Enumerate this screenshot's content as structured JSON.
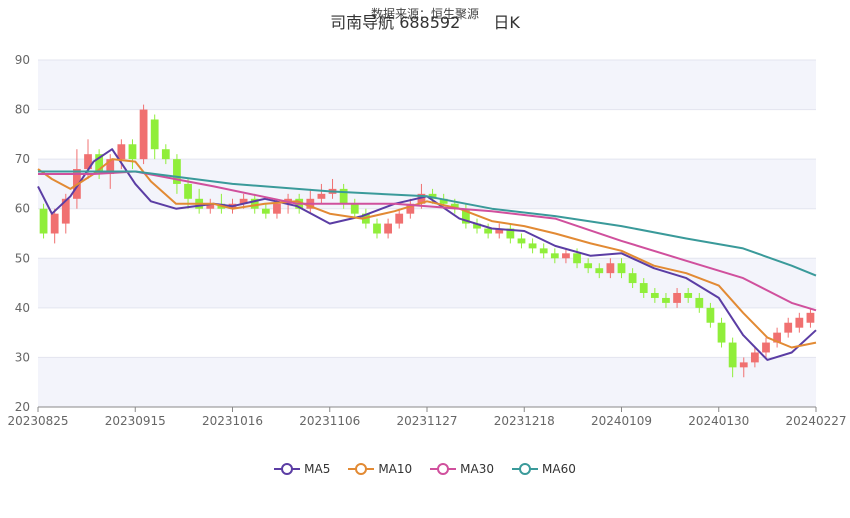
{
  "source": "数据来源：恒生聚源",
  "title": {
    "name": "司南导航 688592",
    "period": "日K"
  },
  "colors": {
    "up": "#f07070",
    "down": "#90ee3a",
    "MA5": "#5b3da4",
    "MA10": "#e28a34",
    "MA30": "#d0509d",
    "MA60": "#3a9a9a"
  },
  "chart_data": {
    "type": "candlestick",
    "ylim": [
      20,
      90
    ],
    "yticks": [
      20,
      30,
      40,
      50,
      60,
      70,
      80,
      90
    ],
    "xticks": [
      "20230825",
      "20230915",
      "20231016",
      "20231106",
      "20231127",
      "20231218",
      "20240109",
      "20240130",
      "20240227"
    ],
    "grid": true,
    "legend_position": "bottom",
    "series": [
      {
        "name": "MA5",
        "x": [
          "20230825",
          "20230828",
          "20230901",
          "20230906",
          "20230910",
          "20230915",
          "20230920",
          "20230928",
          "20231010",
          "20231016",
          "20231023",
          "20231030",
          "20231106",
          "20231113",
          "20231120",
          "20231127",
          "20231204",
          "20231211",
          "20231218",
          "20231225",
          "20240102",
          "20240109",
          "20240116",
          "20240123",
          "20240130",
          "20240206",
          "20240213",
          "20240220",
          "20240227"
        ],
        "values": [
          64.5,
          59,
          62.5,
          69.5,
          72,
          65,
          61.5,
          60,
          61,
          60.5,
          62,
          60.5,
          57,
          58.5,
          61,
          62.5,
          58,
          56,
          55.5,
          52.5,
          50.5,
          51,
          48,
          46,
          42,
          34.5,
          29.5,
          31,
          35.5
        ]
      },
      {
        "name": "MA10",
        "x": [
          "20230825",
          "20230828",
          "20230901",
          "20230906",
          "20230910",
          "20230915",
          "20230920",
          "20230928",
          "20231010",
          "20231016",
          "20231023",
          "20231030",
          "20231106",
          "20231113",
          "20231120",
          "20231127",
          "20231204",
          "20231211",
          "20231218",
          "20231225",
          "20240102",
          "20240109",
          "20240116",
          "20240123",
          "20240130",
          "20240206",
          "20240213",
          "20240220",
          "20240227"
        ],
        "values": [
          68,
          66,
          64,
          67,
          70,
          69.5,
          65.5,
          61,
          61,
          60,
          61,
          61.5,
          59,
          58,
          59.5,
          61.5,
          60,
          57.5,
          56.5,
          55,
          53,
          51.5,
          48.5,
          47,
          44.5,
          39,
          34,
          32,
          33
        ]
      },
      {
        "name": "MA30",
        "x": [
          "20230825",
          "20230906",
          "20230915",
          "20231010",
          "20231030",
          "20231120",
          "20231211",
          "20231225",
          "20240109",
          "20240123",
          "20240206",
          "20240220",
          "20240227"
        ],
        "values": [
          67,
          67,
          67.5,
          64.5,
          61,
          61,
          59.5,
          58,
          53.5,
          49.5,
          46,
          41,
          39.5
        ]
      },
      {
        "name": "MA60",
        "x": [
          "20230825",
          "20230906",
          "20230915",
          "20231016",
          "20231106",
          "20231127",
          "20231211",
          "20231225",
          "20240109",
          "20240123",
          "20240206",
          "20240220",
          "20240227"
        ],
        "values": [
          67.5,
          67.5,
          67.5,
          65,
          63.5,
          62.5,
          60,
          58.5,
          56.5,
          54,
          52,
          48.5,
          46.5
        ]
      }
    ],
    "candles": [
      {
        "o": 60,
        "c": 55,
        "h": 61,
        "l": 54
      },
      {
        "o": 55,
        "c": 59,
        "h": 60,
        "l": 53
      },
      {
        "o": 57,
        "c": 62,
        "h": 63,
        "l": 55
      },
      {
        "o": 62,
        "c": 68,
        "h": 72,
        "l": 60
      },
      {
        "o": 68,
        "c": 71,
        "h": 74,
        "l": 66
      },
      {
        "o": 71,
        "c": 67,
        "h": 72,
        "l": 66
      },
      {
        "o": 67,
        "c": 70,
        "h": 71,
        "l": 64
      },
      {
        "o": 70,
        "c": 73,
        "h": 74,
        "l": 68
      },
      {
        "o": 73,
        "c": 70,
        "h": 74,
        "l": 68
      },
      {
        "o": 70,
        "c": 80,
        "h": 81,
        "l": 69
      },
      {
        "o": 78,
        "c": 72,
        "h": 79,
        "l": 70
      },
      {
        "o": 72,
        "c": 70,
        "h": 73,
        "l": 69
      },
      {
        "o": 70,
        "c": 65,
        "h": 71,
        "l": 63
      },
      {
        "o": 65,
        "c": 62,
        "h": 66,
        "l": 60
      },
      {
        "o": 62,
        "c": 60,
        "h": 64,
        "l": 59
      },
      {
        "o": 60,
        "c": 61,
        "h": 62,
        "l": 59
      },
      {
        "o": 61,
        "c": 60,
        "h": 63,
        "l": 59
      },
      {
        "o": 60,
        "c": 61,
        "h": 62,
        "l": 59
      },
      {
        "o": 61,
        "c": 62,
        "h": 63,
        "l": 60
      },
      {
        "o": 62,
        "c": 60,
        "h": 63,
        "l": 59
      },
      {
        "o": 60,
        "c": 59,
        "h": 61,
        "l": 58
      },
      {
        "o": 59,
        "c": 61,
        "h": 62,
        "l": 58
      },
      {
        "o": 61,
        "c": 62,
        "h": 63,
        "l": 59
      },
      {
        "o": 62,
        "c": 60,
        "h": 63,
        "l": 59
      },
      {
        "o": 60,
        "c": 62,
        "h": 64,
        "l": 59
      },
      {
        "o": 62,
        "c": 63,
        "h": 65,
        "l": 61
      },
      {
        "o": 63,
        "c": 64,
        "h": 66,
        "l": 62
      },
      {
        "o": 64,
        "c": 61,
        "h": 65,
        "l": 60
      },
      {
        "o": 61,
        "c": 59,
        "h": 62,
        "l": 58
      },
      {
        "o": 59,
        "c": 57,
        "h": 60,
        "l": 56
      },
      {
        "o": 57,
        "c": 55,
        "h": 58,
        "l": 54
      },
      {
        "o": 55,
        "c": 57,
        "h": 58,
        "l": 54
      },
      {
        "o": 57,
        "c": 59,
        "h": 60,
        "l": 56
      },
      {
        "o": 59,
        "c": 61,
        "h": 62,
        "l": 58
      },
      {
        "o": 61,
        "c": 63,
        "h": 65,
        "l": 60
      },
      {
        "o": 63,
        "c": 62,
        "h": 64,
        "l": 61
      },
      {
        "o": 62,
        "c": 61,
        "h": 63,
        "l": 60
      },
      {
        "o": 61,
        "c": 60,
        "h": 62,
        "l": 59
      },
      {
        "o": 60,
        "c": 57,
        "h": 61,
        "l": 56
      },
      {
        "o": 57,
        "c": 56,
        "h": 58,
        "l": 55
      },
      {
        "o": 56,
        "c": 55,
        "h": 57,
        "l": 54
      },
      {
        "o": 55,
        "c": 56,
        "h": 57,
        "l": 54
      },
      {
        "o": 56,
        "c": 54,
        "h": 57,
        "l": 53
      },
      {
        "o": 54,
        "c": 53,
        "h": 55,
        "l": 52
      },
      {
        "o": 53,
        "c": 52,
        "h": 54,
        "l": 51
      },
      {
        "o": 52,
        "c": 51,
        "h": 53,
        "l": 50
      },
      {
        "o": 51,
        "c": 50,
        "h": 52,
        "l": 49
      },
      {
        "o": 50,
        "c": 51,
        "h": 52,
        "l": 49
      },
      {
        "o": 51,
        "c": 49,
        "h": 52,
        "l": 48
      },
      {
        "o": 49,
        "c": 48,
        "h": 50,
        "l": 47
      },
      {
        "o": 48,
        "c": 47,
        "h": 49,
        "l": 46
      },
      {
        "o": 47,
        "c": 49,
        "h": 50,
        "l": 46
      },
      {
        "o": 49,
        "c": 47,
        "h": 50,
        "l": 46
      },
      {
        "o": 47,
        "c": 45,
        "h": 48,
        "l": 44
      },
      {
        "o": 45,
        "c": 43,
        "h": 46,
        "l": 42
      },
      {
        "o": 43,
        "c": 42,
        "h": 44,
        "l": 41
      },
      {
        "o": 42,
        "c": 41,
        "h": 43,
        "l": 40
      },
      {
        "o": 41,
        "c": 43,
        "h": 44,
        "l": 40
      },
      {
        "o": 43,
        "c": 42,
        "h": 44,
        "l": 41
      },
      {
        "o": 42,
        "c": 40,
        "h": 43,
        "l": 39
      },
      {
        "o": 40,
        "c": 37,
        "h": 41,
        "l": 36
      },
      {
        "o": 37,
        "c": 33,
        "h": 38,
        "l": 32
      },
      {
        "o": 33,
        "c": 28,
        "h": 34,
        "l": 26
      },
      {
        "o": 28,
        "c": 29,
        "h": 30,
        "l": 26
      },
      {
        "o": 29,
        "c": 31,
        "h": 32,
        "l": 28
      },
      {
        "o": 31,
        "c": 33,
        "h": 34,
        "l": 30
      },
      {
        "o": 33,
        "c": 35,
        "h": 36,
        "l": 32
      },
      {
        "o": 35,
        "c": 37,
        "h": 38,
        "l": 34
      },
      {
        "o": 36,
        "c": 38,
        "h": 39,
        "l": 35
      },
      {
        "o": 37,
        "c": 39,
        "h": 40,
        "l": 36
      }
    ]
  }
}
